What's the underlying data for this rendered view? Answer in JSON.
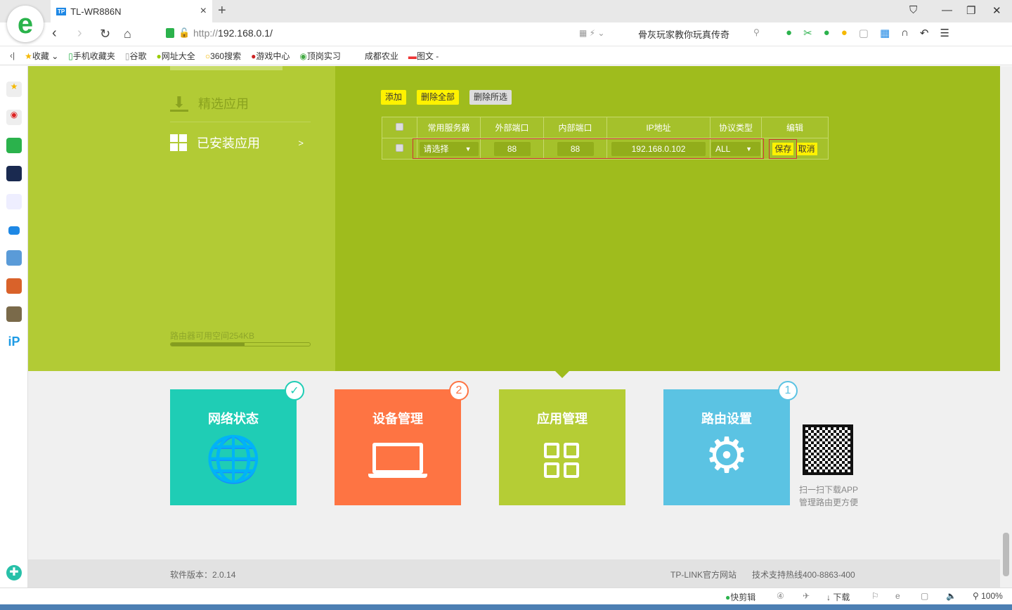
{
  "browser": {
    "tab_title": "TL-WR886N",
    "tab_favicon": "TP",
    "url_scheme": "http://",
    "url_host": "192.168.0.1/",
    "search_text": "骨灰玩家教你玩真传奇",
    "bookmarks": [
      "收藏",
      "手机收藏夹",
      "谷歌",
      "网址大全",
      "360搜索",
      "游戏中心",
      "顶岗实习",
      "成都农业",
      "图文 -"
    ],
    "status": {
      "quick_edit": "快剪辑",
      "download": "下载",
      "zoom": "100%"
    }
  },
  "menu": {
    "items": [
      {
        "label": "精选应用",
        "icon": "download-icon"
      },
      {
        "label": "已安装应用",
        "icon": "grid-icon",
        "arrow": ">"
      }
    ],
    "storage_label": "路由器可用空间254KB",
    "storage_used_fraction": 0.53
  },
  "toolbar": {
    "add": "添加",
    "delete_all": "删除全部",
    "delete_selected": "删除所选"
  },
  "table": {
    "headers": [
      "常用服务器",
      "外部端口",
      "内部端口",
      "IP地址",
      "协议类型",
      "编辑"
    ],
    "row": {
      "server": "请选择",
      "external_port": "88",
      "internal_port": "88",
      "ip": "192.168.0.102",
      "protocol": "ALL",
      "save": "保存",
      "cancel": "取消"
    }
  },
  "tiles": [
    {
      "label": "网络状态",
      "color": "#1fcdb5",
      "badge": "✓"
    },
    {
      "label": "设备管理",
      "color": "#fe7443",
      "badge": "2"
    },
    {
      "label": "应用管理",
      "color": "#b5cd35",
      "badge": ""
    },
    {
      "label": "路由设置",
      "color": "#5bc3e3",
      "badge": "1"
    }
  ],
  "qr": {
    "line1": "扫一扫下载APP",
    "line2": "管理路由更方便"
  },
  "footer": {
    "version": "软件版本：2.0.14",
    "site": "TP-LINK官方网站",
    "hotline": "技术支持热线400-8863-400"
  }
}
